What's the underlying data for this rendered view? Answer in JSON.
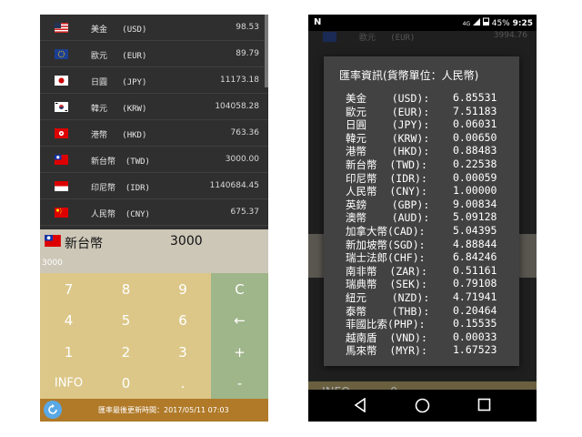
{
  "left": {
    "currencies": [
      {
        "name": "美金",
        "code": "(USD)",
        "value": "98.53",
        "flag": "us-flag-icon"
      },
      {
        "name": "歐元",
        "code": "(EUR)",
        "value": "89.79",
        "flag": "eu-flag-icon"
      },
      {
        "name": "日圓",
        "code": "(JPY)",
        "value": "11173.18",
        "flag": "jp-flag-icon"
      },
      {
        "name": "韓元",
        "code": "(KRW)",
        "value": "104058.28",
        "flag": "kr-flag-icon"
      },
      {
        "name": "港幣",
        "code": "(HKD)",
        "value": "763.36",
        "flag": "hk-flag-icon"
      },
      {
        "name": "新台幣",
        "code": "(TWD)",
        "value": "3000.00",
        "flag": "tw-flag-icon"
      },
      {
        "name": "印尼幣",
        "code": "(IDR)",
        "value": "1140684.45",
        "flag": "id-flag-icon"
      },
      {
        "name": "人民幣",
        "code": "(CNY)",
        "value": "675.37",
        "flag": "cn-flag-icon"
      }
    ],
    "input": {
      "currency": "新台幣",
      "value": "3000",
      "sub": "3000"
    },
    "keys": {
      "k7": "7",
      "k8": "8",
      "k9": "9",
      "clear": "C",
      "k4": "4",
      "k5": "5",
      "k6": "6",
      "backspace": "←",
      "k1": "1",
      "k2": "2",
      "k3": "3",
      "plus": "+",
      "info": "INFO",
      "k0": "0",
      "dot": ".",
      "minus": "-"
    },
    "status": {
      "last_update": "匯率最後更新時間：2017/05/11 07:03"
    }
  },
  "right": {
    "statusbar": {
      "notification": "N",
      "network": "4G",
      "battery": "45%",
      "time": "9:25"
    },
    "background": {
      "row_name": "歐元   (EUR)",
      "row_value": "3994.76",
      "info": "INFO",
      "zero": "0",
      "dot": ".",
      "minus": "-"
    },
    "dialog": {
      "title": "匯率資訊(貨幣單位：人民幣)",
      "rates": [
        {
          "name": "美金",
          "code": "(USD):",
          "value": "6.85531"
        },
        {
          "name": "歐元",
          "code": "(EUR):",
          "value": "7.51183"
        },
        {
          "name": "日圓",
          "code": "(JPY):",
          "value": "0.06031"
        },
        {
          "name": "韓元",
          "code": "(KRW):",
          "value": "0.00650"
        },
        {
          "name": "港幣",
          "code": "(HKD):",
          "value": "0.88483"
        },
        {
          "name": "新台幣",
          "code": "(TWD):",
          "value": "0.22538"
        },
        {
          "name": "印尼幣",
          "code": "(IDR):",
          "value": "0.00059"
        },
        {
          "name": "人民幣",
          "code": "(CNY):",
          "value": "1.00000"
        },
        {
          "name": "英鎊",
          "code": "(GBP):",
          "value": "9.00834"
        },
        {
          "name": "澳幣",
          "code": "(AUD):",
          "value": "5.09128"
        },
        {
          "name": "加拿大幣",
          "code": "(CAD):",
          "value": "5.04395"
        },
        {
          "name": "新加坡幣",
          "code": "(SGD):",
          "value": "4.88844"
        },
        {
          "name": "瑞士法郎",
          "code": "(CHF):",
          "value": "6.84246"
        },
        {
          "name": "南非幣",
          "code": "(ZAR):",
          "value": "0.51161"
        },
        {
          "name": "瑞典幣",
          "code": "(SEK):",
          "value": "0.79108"
        },
        {
          "name": "紐元",
          "code": "(NZD):",
          "value": "4.71941"
        },
        {
          "name": "泰幣",
          "code": "(THB):",
          "value": "0.20464"
        },
        {
          "name": "菲國比索",
          "code": "(PHP):",
          "value": "0.15535"
        },
        {
          "name": "越南盾",
          "code": "(VND):",
          "value": "0.00033"
        },
        {
          "name": "馬來幣",
          "code": "(MYR):",
          "value": "1.67523"
        }
      ]
    }
  },
  "colors": {
    "keypad": "#dcc788",
    "operator_keys": "#9fb58a",
    "status_bar": "#b07a29",
    "list_bg": "#2f2f2f",
    "dialog_bg": "#424242"
  }
}
